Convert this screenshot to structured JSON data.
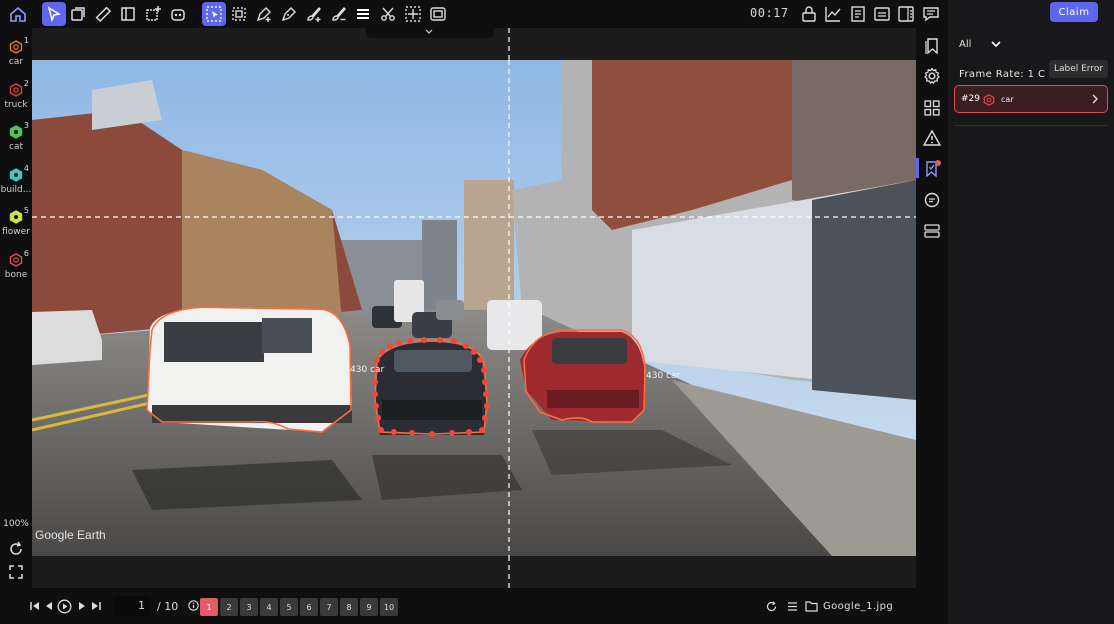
{
  "toolbar": {
    "tools": [
      "home-icon",
      "select-icon",
      "rectangle-icon",
      "ruler-icon",
      "panel-icon",
      "add-box-icon",
      "robot-icon",
      "auto-select-icon",
      "crop-icon",
      "pen-add-icon",
      "pen-icon",
      "brush-add-icon",
      "brush-remove-icon",
      "menu-icon",
      "scissors-icon",
      "grid-icon",
      "frame-icon"
    ],
    "timer": "00:17",
    "right_tools": [
      "lock-icon",
      "chart-icon",
      "document-icon",
      "subtitle-icon",
      "split-icon",
      "comment-icon"
    ],
    "accent": "#5f67ee"
  },
  "labels": [
    {
      "num": "1",
      "name": "car",
      "color": "#f07a22"
    },
    {
      "num": "2",
      "name": "truck",
      "color": "#e8463f"
    },
    {
      "num": "3",
      "name": "cat",
      "color": "#4fc25a"
    },
    {
      "num": "4",
      "name": "build...",
      "color": "#45c7b0"
    },
    {
      "num": "5",
      "name": "flower",
      "color": "#c8e04a"
    },
    {
      "num": "6",
      "name": "bone",
      "color": "#e65050"
    }
  ],
  "zoom": "100%",
  "canvas": {
    "watermark": "Google Earth",
    "annotation_labels": [
      "430 car",
      "430 car"
    ],
    "label_colors": {
      "car": "#ff6a3d",
      "point": "#f0473e"
    }
  },
  "panel": {
    "claim_label": "Claim",
    "filter": "All",
    "frame_rate": "Frame Rate: 1 C",
    "tooltip": "Label Error",
    "objects": [
      {
        "id": "#29",
        "name": "car"
      }
    ]
  },
  "bottom": {
    "current_page": "1",
    "total": "/ 10",
    "frames": [
      "1",
      "2",
      "3",
      "4",
      "5",
      "6",
      "7",
      "8",
      "9",
      "10"
    ],
    "current_frame": "1",
    "filename": "Google_1.jpg"
  }
}
